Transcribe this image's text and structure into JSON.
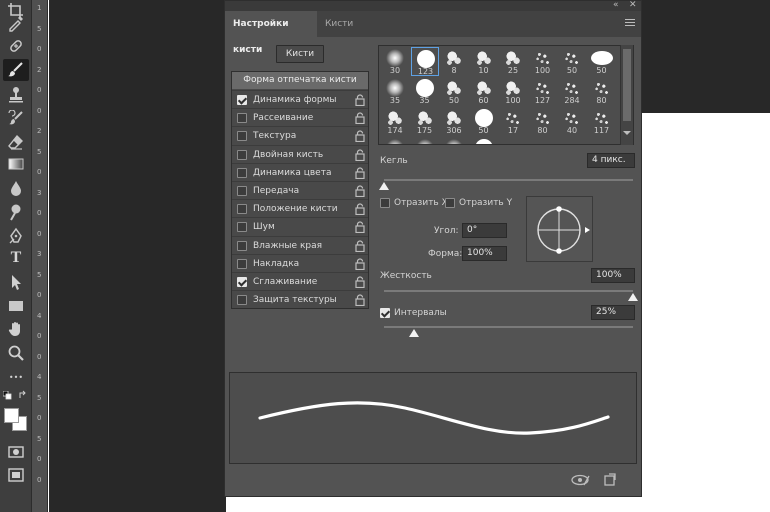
{
  "toolbar": {
    "tools": [
      {
        "icon": "crop-icon"
      },
      {
        "icon": "eyedropper-icon"
      },
      {
        "icon": "healing-brush-icon"
      },
      {
        "icon": "brush-icon",
        "active": true
      },
      {
        "icon": "clone-stamp-icon"
      },
      {
        "icon": "history-brush-icon"
      },
      {
        "icon": "eraser-icon"
      },
      {
        "icon": "gradient-icon"
      },
      {
        "icon": "blur-drop-icon"
      },
      {
        "icon": "dodge-icon"
      },
      {
        "icon": "pen-icon"
      },
      {
        "icon": "type-icon"
      },
      {
        "icon": "path-selection-icon"
      },
      {
        "icon": "rectangle-icon"
      },
      {
        "icon": "hand-icon"
      },
      {
        "icon": "zoom-icon"
      },
      {
        "icon": "more-tools-icon"
      }
    ],
    "extra": [
      "swap-colors-icon",
      "quick-mask-icon",
      "screen-mode-icon"
    ],
    "type_glyph": "T",
    "more_glyph": "•••"
  },
  "ruler": {
    "numbers": [
      "1",
      "5",
      "0",
      "2",
      "0",
      "0",
      "2",
      "5",
      "0",
      "3",
      "0",
      "0",
      "3",
      "5",
      "0",
      "4",
      "0",
      "0",
      "4",
      "5",
      "0",
      "5",
      "0",
      "0"
    ]
  },
  "panel": {
    "collapse_glyph": "«",
    "close_glyph": "✕",
    "tabs": [
      {
        "label": "Настройки кисти",
        "active": true
      },
      {
        "label": "Кисти",
        "active": false
      }
    ],
    "brushes_button": "Кисти",
    "options_header": "Форма отпечатка кисти",
    "options": [
      {
        "label": "Динамика формы",
        "checked": true
      },
      {
        "label": "Рассеивание",
        "checked": false
      },
      {
        "label": "Текстура",
        "checked": false
      },
      {
        "label": "Двойная кисть",
        "checked": false
      },
      {
        "label": "Динамика цвета",
        "checked": false
      },
      {
        "label": "Передача",
        "checked": false
      },
      {
        "label": "Положение кисти",
        "checked": false
      },
      {
        "label": "Шум",
        "checked": false
      },
      {
        "label": "Влажные края",
        "checked": false
      },
      {
        "label": "Накладка",
        "checked": false
      },
      {
        "label": "Сглаживание",
        "checked": true
      },
      {
        "label": "Защита текстуры",
        "checked": false
      }
    ],
    "presets": [
      {
        "size": "30",
        "kind": "soft"
      },
      {
        "size": "123",
        "kind": "hard",
        "selected": true
      },
      {
        "size": "8",
        "kind": "splat"
      },
      {
        "size": "10",
        "kind": "splat"
      },
      {
        "size": "25",
        "kind": "splat"
      },
      {
        "size": "100",
        "kind": "spray"
      },
      {
        "size": "50",
        "kind": "spray"
      },
      {
        "size": "50",
        "kind": "oval"
      },
      {
        "size": "35",
        "kind": "soft"
      },
      {
        "size": "35",
        "kind": "hard"
      },
      {
        "size": "50",
        "kind": "splat"
      },
      {
        "size": "60",
        "kind": "splat"
      },
      {
        "size": "100",
        "kind": "splat"
      },
      {
        "size": "127",
        "kind": "spray"
      },
      {
        "size": "284",
        "kind": "spray"
      },
      {
        "size": "80",
        "kind": "spray"
      },
      {
        "size": "174",
        "kind": "splat"
      },
      {
        "size": "175",
        "kind": "splat"
      },
      {
        "size": "306",
        "kind": "splat"
      },
      {
        "size": "50",
        "kind": "hard"
      },
      {
        "size": "17",
        "kind": "spray"
      },
      {
        "size": "80",
        "kind": "spray"
      },
      {
        "size": "40",
        "kind": "spray"
      },
      {
        "size": "117",
        "kind": "spray"
      },
      {
        "size": "",
        "kind": "soft"
      },
      {
        "size": "",
        "kind": "soft"
      },
      {
        "size": "",
        "kind": "soft"
      },
      {
        "size": "",
        "kind": "hard"
      }
    ],
    "size_label": "Кегль",
    "size_value": "4 пикс.",
    "size_slider": 0.0,
    "flip_x_label": "Отразить X",
    "flip_y_label": "Отразить Y",
    "angle_label": "Угол:",
    "angle_value": "0°",
    "roundness_label": "Форма:",
    "roundness_value": "100%",
    "hardness_label": "Жесткость",
    "hardness_value": "100%",
    "hardness_slider": 1.0,
    "spacing_label": "Интервалы",
    "spacing_checked": true,
    "spacing_value": "25%",
    "spacing_slider": 0.12,
    "footer_icons": [
      "toggle-preview-icon",
      "new-brush-icon"
    ]
  }
}
